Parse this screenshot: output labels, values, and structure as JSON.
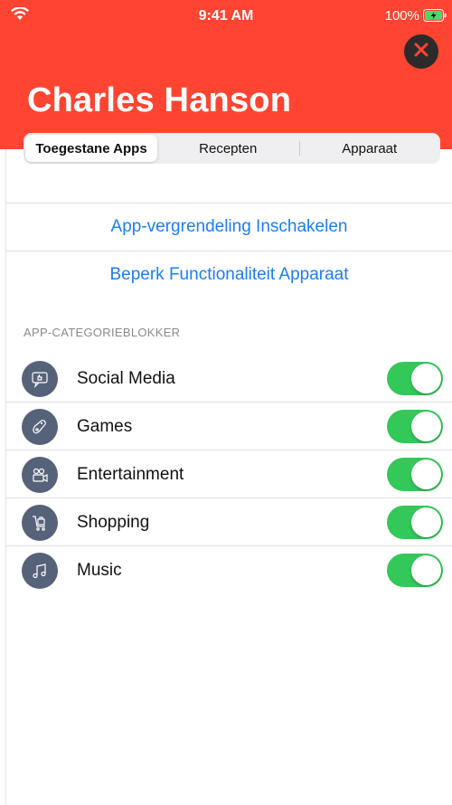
{
  "status_bar": {
    "time": "9:41 AM",
    "battery": "100%",
    "wifi_icon": "wifi-icon",
    "battery_icon": "battery-charging-icon"
  },
  "header": {
    "title": "Charles Hanson",
    "close_icon": "close-icon",
    "background_color": "#ff4532"
  },
  "tabs": [
    {
      "label": "Toegestane Apps",
      "selected": true
    },
    {
      "label": "Recepten",
      "selected": false
    },
    {
      "label": "Apparaat",
      "selected": false
    }
  ],
  "actions": {
    "app_lock": "App-vergrendeling Inschakelen",
    "restrict": "Beperk Functionaliteit Apparaat",
    "link_color": "#1a7ef5"
  },
  "section": {
    "label": "APP-CATEGORIEBLOKKER"
  },
  "categories": [
    {
      "label": "Social Media",
      "icon": "chat-bubble-icon",
      "enabled": true
    },
    {
      "label": "Games",
      "icon": "gamepad-icon",
      "enabled": true
    },
    {
      "label": "Entertainment",
      "icon": "video-camera-icon",
      "enabled": true
    },
    {
      "label": "Shopping",
      "icon": "shopping-cart-icon",
      "enabled": true
    },
    {
      "label": "Music",
      "icon": "music-note-icon",
      "enabled": true
    }
  ],
  "toggle_color": "#34c759"
}
